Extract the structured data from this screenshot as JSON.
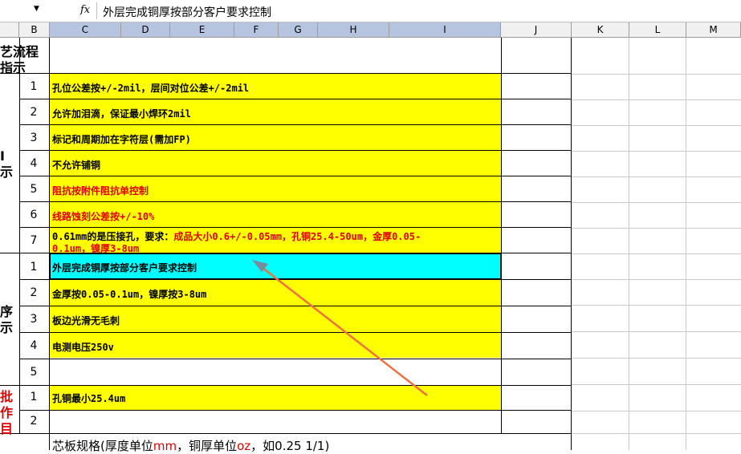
{
  "formula_bar": {
    "fx_symbol": "fx",
    "content": "外层完成铜厚按部分客户要求控制"
  },
  "columns": [
    "B",
    "C",
    "D",
    "E",
    "F",
    "G",
    "H",
    "I",
    "J",
    "K",
    "L",
    "M"
  ],
  "side_labels": {
    "top_line1": "艺流程",
    "top_line2": "指示",
    "group1": "I\n示",
    "group2": "序\n示",
    "group3_line1": "批",
    "group3_line2": "作",
    "group3_line3": "目"
  },
  "rows_group1": [
    {
      "num": "1",
      "text": "孔位公差按+/-2mil，层间对位公差+/-2mil",
      "red": false
    },
    {
      "num": "2",
      "text": "允许加泪滴，保证最小焊环2mil",
      "red": false
    },
    {
      "num": "3",
      "text": "标记和周期加在字符层(需加FP)",
      "red": false
    },
    {
      "num": "4",
      "text": "不允许铺铜",
      "red": false
    },
    {
      "num": "5",
      "text": "阻抗按附件阻抗单控制",
      "red": true
    },
    {
      "num": "6",
      "text": "线路蚀刻公差按+/-10%",
      "red": true
    },
    {
      "num": "7",
      "text_black": "0.61mm的是压接孔，要求：",
      "text_red_1": "成品大小0.6+/-0.05mm，孔铜25.4-50um，金厚0.05-",
      "text_red_2": "0.1um，镍厚3-8um"
    }
  ],
  "rows_group2": [
    {
      "num": "1",
      "text": "外层完成铜厚按部分客户要求控制",
      "selected": true
    },
    {
      "num": "2",
      "text": "金厚按0.05-0.1um，镍厚按3-8um"
    },
    {
      "num": "3",
      "text": "板边光滑无毛刺"
    },
    {
      "num": "4",
      "text": "电测电压250v"
    },
    {
      "num": "5",
      "text": ""
    }
  ],
  "rows_group3": [
    {
      "num": "1",
      "text": "孔铜最小25.4um"
    },
    {
      "num": "2",
      "text": ""
    }
  ],
  "bottom_row": {
    "text_a": "芯板规格(厚度单位",
    "text_b": "mm",
    "text_c": "，铜厚单位",
    "text_d": "oz",
    "text_e": "，如0.25 1/1)"
  },
  "colors": {
    "highlight_yellow": "#ffff00",
    "selected_cyan": "#00ffff",
    "annotation_arrow": "#f07040"
  }
}
